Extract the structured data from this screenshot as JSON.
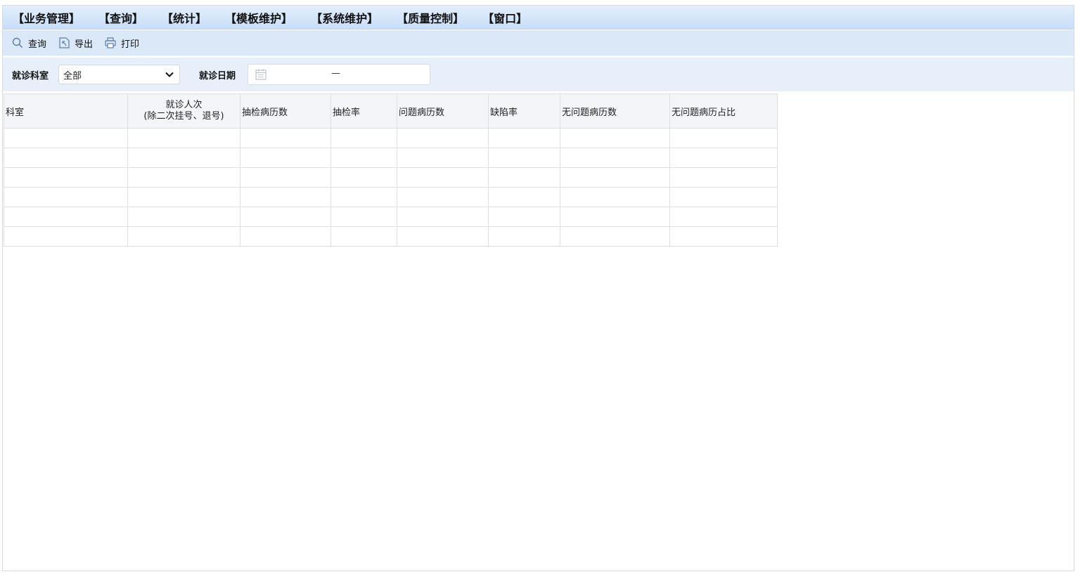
{
  "menubar": {
    "items": [
      "【业务管理】",
      "【查询】",
      "【统计】",
      "【模板维护】",
      "【系统维护】",
      "【质量控制】",
      "【窗口】"
    ]
  },
  "toolbar": {
    "buttons": [
      {
        "label": "查询",
        "icon": "search-icon"
      },
      {
        "label": "导出",
        "icon": "export-icon"
      },
      {
        "label": "打印",
        "icon": "print-icon"
      }
    ]
  },
  "filter": {
    "dept_label": "就诊科室",
    "dept_value": "全部",
    "date_label": "就诊日期",
    "date_separator": "—"
  },
  "table": {
    "columns": [
      "科室",
      "就诊人次",
      "(除二次挂号、退号)",
      "抽检病历数",
      "抽检率",
      "问题病历数",
      "缺陷率",
      "无问题病历数",
      "无问题病历占比"
    ],
    "empty_rows": 6
  },
  "colors": {
    "menubar": "#c8defa",
    "toolbar": "#dbe8f8",
    "filter": "#e6effa",
    "icon": "#5a7ea6"
  }
}
